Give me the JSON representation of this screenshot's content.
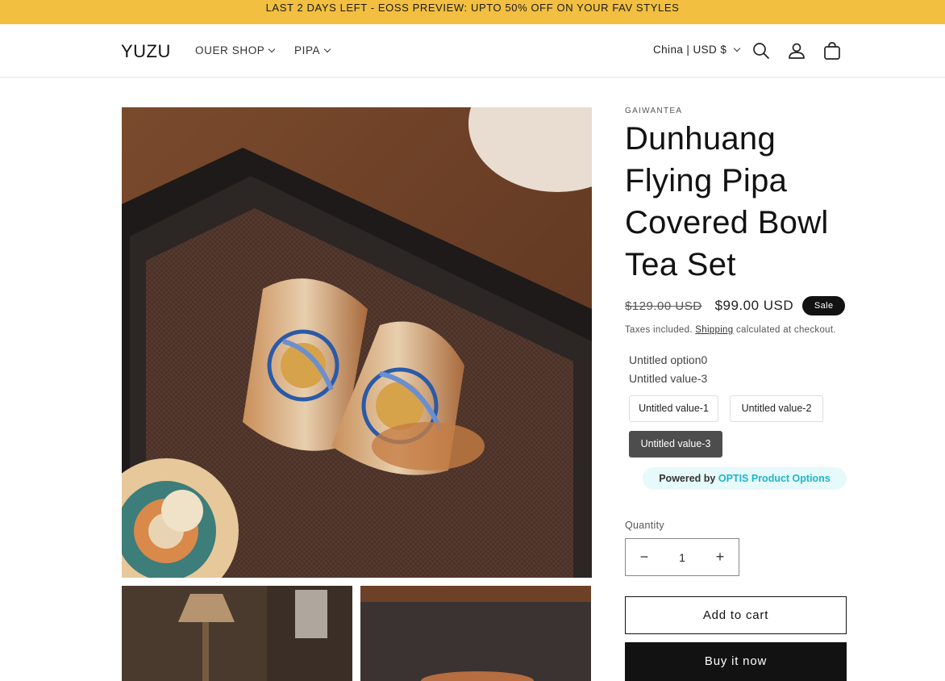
{
  "announcement": "LAST 2 DAYS LEFT - EOSS PREVIEW: UPTO 50% OFF ON YOUR FAV STYLES",
  "header": {
    "logo": "YUZU",
    "nav": [
      {
        "label": "OUER SHOP"
      },
      {
        "label": "PIPA"
      }
    ],
    "locale": "China | USD $",
    "icons": [
      "search-icon",
      "account-icon",
      "cart-icon"
    ]
  },
  "product": {
    "vendor": "GAIWANTEA",
    "title": "Dunhuang Flying Pipa Covered Bowl Tea Set",
    "price_regular": "$129.00 USD",
    "price_sale": "$99.00 USD",
    "sale_badge": "Sale",
    "tax_prefix": "Taxes included.",
    "tax_link": "Shipping",
    "tax_suffix": "calculated at checkout.",
    "option": {
      "name": "Untitled option0",
      "selected_value": "Untitled value-3",
      "values": [
        "Untitled value-1",
        "Untitled value-2",
        "Untitled value-3"
      ]
    },
    "powered_prefix": "Powered by",
    "powered_brand": "OPTIS Product Options",
    "quantity_label": "Quantity",
    "quantity": "1",
    "add_to_cart": "Add to cart",
    "buy_now": "Buy it now"
  },
  "colors": {
    "announcement_bg": "#f2bf41",
    "button_dark": "#121212",
    "selected_option": "#4d4d4d",
    "powered_bg": "#e6f9fb",
    "powered_brand": "#1fb5c8"
  }
}
